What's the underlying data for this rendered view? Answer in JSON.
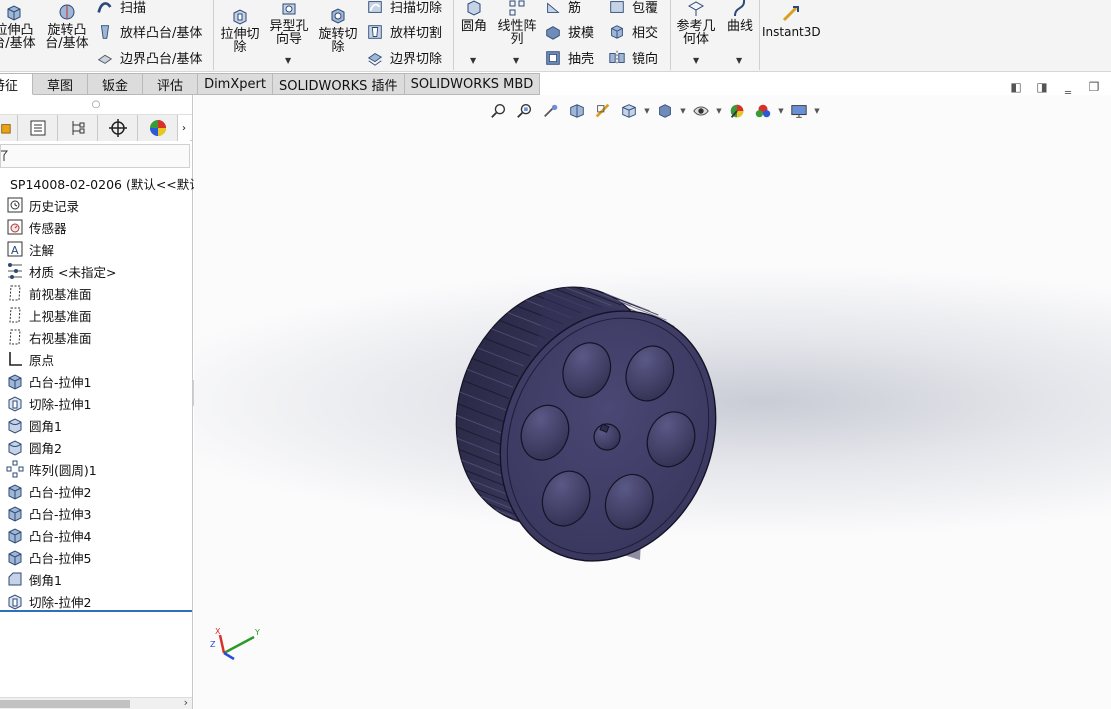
{
  "ribbon": {
    "sweep": "扫描",
    "extrude_boss_cut": "拉伸凸\n台/基体",
    "revolve_boss": "旋转凸\n台/基体",
    "loft_boss": "放样凸台/基体",
    "boundary_boss": "边界凸台/基体",
    "extrude_cut": "拉伸切\n除",
    "hole_wizard": "异型孔\n向导",
    "revolve_cut": "旋转切\n除",
    "sweep_cut": "扫描切除",
    "loft_cut": "放样切割",
    "boundary_cut": "边界切除",
    "fillet": "圆角",
    "linear_pattern": "线性阵\n列",
    "rib": "筋",
    "draft": "拔模",
    "shell": "抽壳",
    "wrap": "包覆",
    "intersect": "相交",
    "mirror": "镜向",
    "ref_geometry": "参考几\n何体",
    "curves": "曲线",
    "instant3d": "Instant3D"
  },
  "tabs": [
    {
      "label": "特征",
      "active": true
    },
    {
      "label": "草图",
      "active": false
    },
    {
      "label": "钣金",
      "active": false
    },
    {
      "label": "评估",
      "active": false
    },
    {
      "label": "DimXpert",
      "active": false
    },
    {
      "label": "SOLIDWORKS 插件",
      "active": false
    },
    {
      "label": "SOLIDWORKS MBD",
      "active": false
    }
  ],
  "tree": {
    "root": "SP14008-02-0206  (默认<<默认>",
    "items": [
      {
        "label": "历史记录",
        "icon": "history-icon"
      },
      {
        "label": "传感器",
        "icon": "sensor-icon"
      },
      {
        "label": "注解",
        "icon": "annotation-icon"
      },
      {
        "label": "材质 <未指定>",
        "icon": "material-icon"
      },
      {
        "label": "前视基准面",
        "icon": "plane-icon"
      },
      {
        "label": "上视基准面",
        "icon": "plane-icon"
      },
      {
        "label": "右视基准面",
        "icon": "plane-icon"
      },
      {
        "label": "原点",
        "icon": "origin-icon"
      },
      {
        "label": "凸台-拉伸1",
        "icon": "boss-extrude-icon"
      },
      {
        "label": "切除-拉伸1",
        "icon": "cut-extrude-icon"
      },
      {
        "label": "圆角1",
        "icon": "fillet-icon"
      },
      {
        "label": "圆角2",
        "icon": "fillet-icon"
      },
      {
        "label": "阵列(圆周)1",
        "icon": "circular-pattern-icon"
      },
      {
        "label": "凸台-拉伸2",
        "icon": "boss-extrude-icon"
      },
      {
        "label": "凸台-拉伸3",
        "icon": "boss-extrude-icon"
      },
      {
        "label": "凸台-拉伸4",
        "icon": "boss-extrude-icon"
      },
      {
        "label": "凸台-拉伸5",
        "icon": "boss-extrude-icon"
      },
      {
        "label": "倒角1",
        "icon": "chamfer-icon"
      },
      {
        "label": "切除-拉伸2",
        "icon": "cut-extrude-icon"
      }
    ]
  },
  "colors": {
    "part_face": "#3d3b63",
    "part_edge": "#141326",
    "accent": "#2f6fba"
  },
  "triad": {
    "x": "X",
    "y": "Y",
    "z": "Z"
  }
}
